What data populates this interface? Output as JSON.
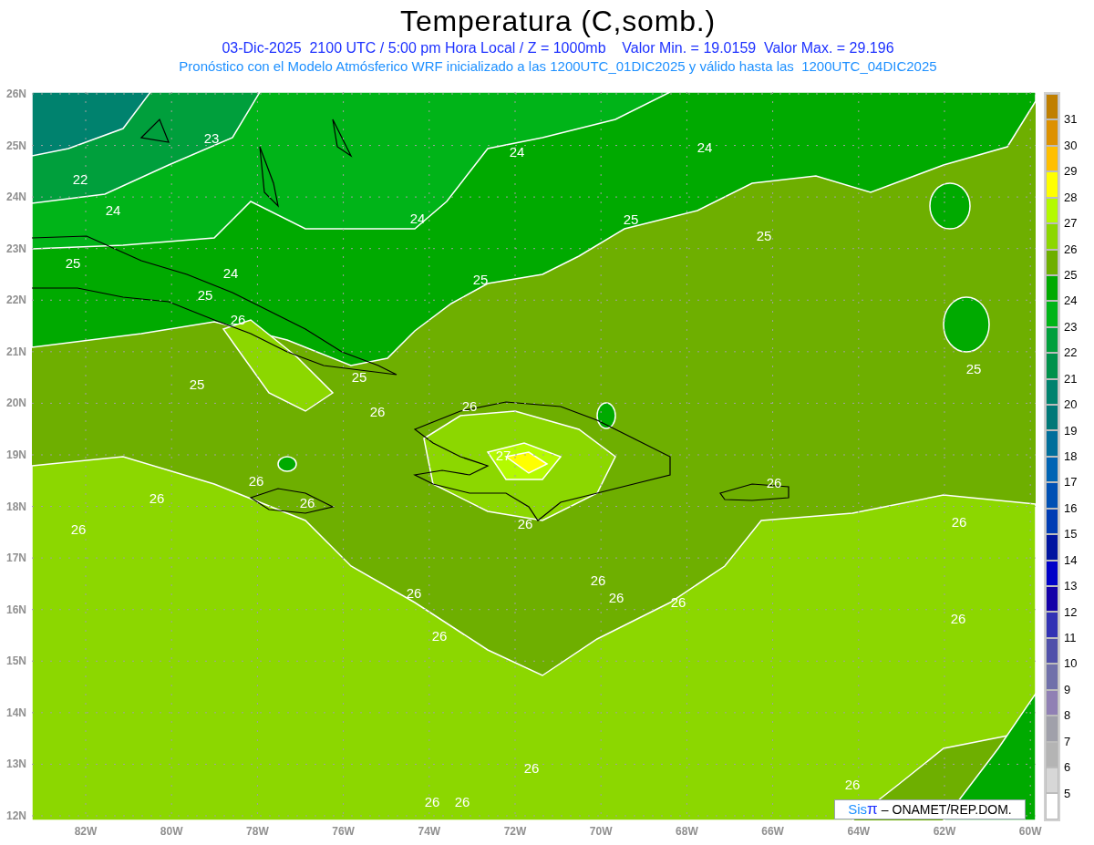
{
  "title": "Temperatura (C,somb.)",
  "subtitle": "03-Dic-2025  2100 UTC / 5:00 pm Hora Local / Z = 1000mb    Valor Min. = 19.0159  Valor Max. = 29.196",
  "model_info": "Pronóstico con el Modelo Atmósferico WRF inicializado a las 1200UTC_01DIC2025 y válido hasta las  1200UTC_04DIC2025",
  "map": {
    "contour_labels": [
      "23",
      "22",
      "24",
      "24",
      "24",
      "24",
      "25",
      "25",
      "25",
      "24",
      "25",
      "25",
      "26",
      "25",
      "25",
      "25",
      "26",
      "26",
      "27",
      "26",
      "26",
      "26",
      "26",
      "26",
      "26",
      "26",
      "26",
      "26",
      "26",
      "26",
      "26",
      "26",
      "26",
      "26",
      "26",
      "26"
    ]
  },
  "y_axis": {
    "ticks": [
      "26N",
      "25N",
      "24N",
      "23N",
      "22N",
      "21N",
      "20N",
      "19N",
      "18N",
      "17N",
      "16N",
      "15N",
      "14N",
      "13N",
      "12N"
    ]
  },
  "x_axis": {
    "ticks": [
      "82W",
      "80W",
      "78W",
      "76W",
      "74W",
      "72W",
      "70W",
      "68W",
      "66W",
      "64W",
      "62W",
      "60W"
    ]
  },
  "colorbar": {
    "swatches": [
      {
        "color": "#c07f00"
      },
      {
        "color": "#dd9100"
      },
      {
        "color": "#ffbf00"
      },
      {
        "color": "#ffff00"
      },
      {
        "color": "#b4fa00"
      },
      {
        "color": "#8cd700"
      },
      {
        "color": "#6eaf00"
      },
      {
        "color": "#00aa00"
      },
      {
        "color": "#00b418"
      },
      {
        "color": "#009f3c"
      },
      {
        "color": "#00914b"
      },
      {
        "color": "#00826e"
      },
      {
        "color": "#007878"
      },
      {
        "color": "#006e9b"
      },
      {
        "color": "#0064b4"
      },
      {
        "color": "#0050b4"
      },
      {
        "color": "#003cb4"
      },
      {
        "color": "#0014a0"
      },
      {
        "color": "#0000c8"
      },
      {
        "color": "#1400a8"
      },
      {
        "color": "#3232b4"
      },
      {
        "color": "#5050aa"
      },
      {
        "color": "#7070aa"
      },
      {
        "color": "#9080b4"
      },
      {
        "color": "#a0a0aa"
      },
      {
        "color": "#b4b4b4"
      },
      {
        "color": "#d7d7d7"
      },
      {
        "color": "#ffffff"
      }
    ],
    "labels": [
      "31",
      "30",
      "29",
      "28",
      "27",
      "26",
      "25",
      "24",
      "23",
      "22",
      "21",
      "20",
      "19",
      "18",
      "17",
      "16",
      "15",
      "14",
      "13",
      "12",
      "11",
      "10",
      "9",
      "8",
      "7",
      "6",
      "5"
    ]
  },
  "credit": {
    "logo_sis": "Sis",
    "logo_pi": "π",
    "text": "– ONAMET/REP.DOM."
  }
}
